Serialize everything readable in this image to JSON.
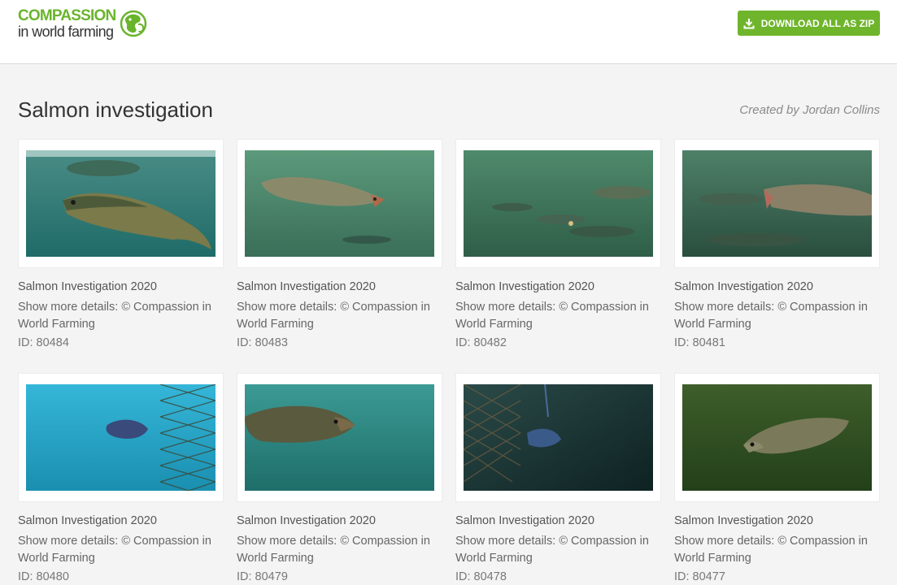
{
  "brand": {
    "line1": "COMPASSION",
    "line2": "in world farming",
    "green": "#6ab42d"
  },
  "toolbar": {
    "download_label": "DOWNLOAD ALL AS ZIP",
    "download_icon": "download-icon",
    "button_color": "#6fb52c"
  },
  "page": {
    "title": "Salmon investigation",
    "created_by": "Created by Jordan Collins"
  },
  "items": [
    {
      "title": "Salmon Investigation 2020",
      "details": "Show more details: © Compassion in World Farming",
      "id": "ID: 80484",
      "tint": "#2f7a73"
    },
    {
      "title": "Salmon Investigation 2020",
      "details": "Show more details: © Compassion in World Farming",
      "id": "ID: 80483",
      "tint": "#3f7e63"
    },
    {
      "title": "Salmon Investigation 2020",
      "details": "Show more details: © Compassion in World Farming",
      "id": "ID: 80482",
      "tint": "#3b7a5e"
    },
    {
      "title": "Salmon Investigation 2020",
      "details": "Show more details: © Compassion in World Farming",
      "id": "ID: 80481",
      "tint": "#37705a"
    },
    {
      "title": "Salmon Investigation 2020",
      "details": "Show more details: © Compassion in World Farming",
      "id": "ID: 80480",
      "tint": "#1f9fc0"
    },
    {
      "title": "Salmon Investigation 2020",
      "details": "Show more details: © Compassion in World Farming",
      "id": "ID: 80479",
      "tint": "#2d8a86"
    },
    {
      "title": "Salmon Investigation 2020",
      "details": "Show more details: © Compassion in World Farming",
      "id": "ID: 80478",
      "tint": "#1c3a3a"
    },
    {
      "title": "Salmon Investigation 2020",
      "details": "Show more details: © Compassion in World Farming",
      "id": "ID: 80477",
      "tint": "#2e4a1e"
    }
  ]
}
